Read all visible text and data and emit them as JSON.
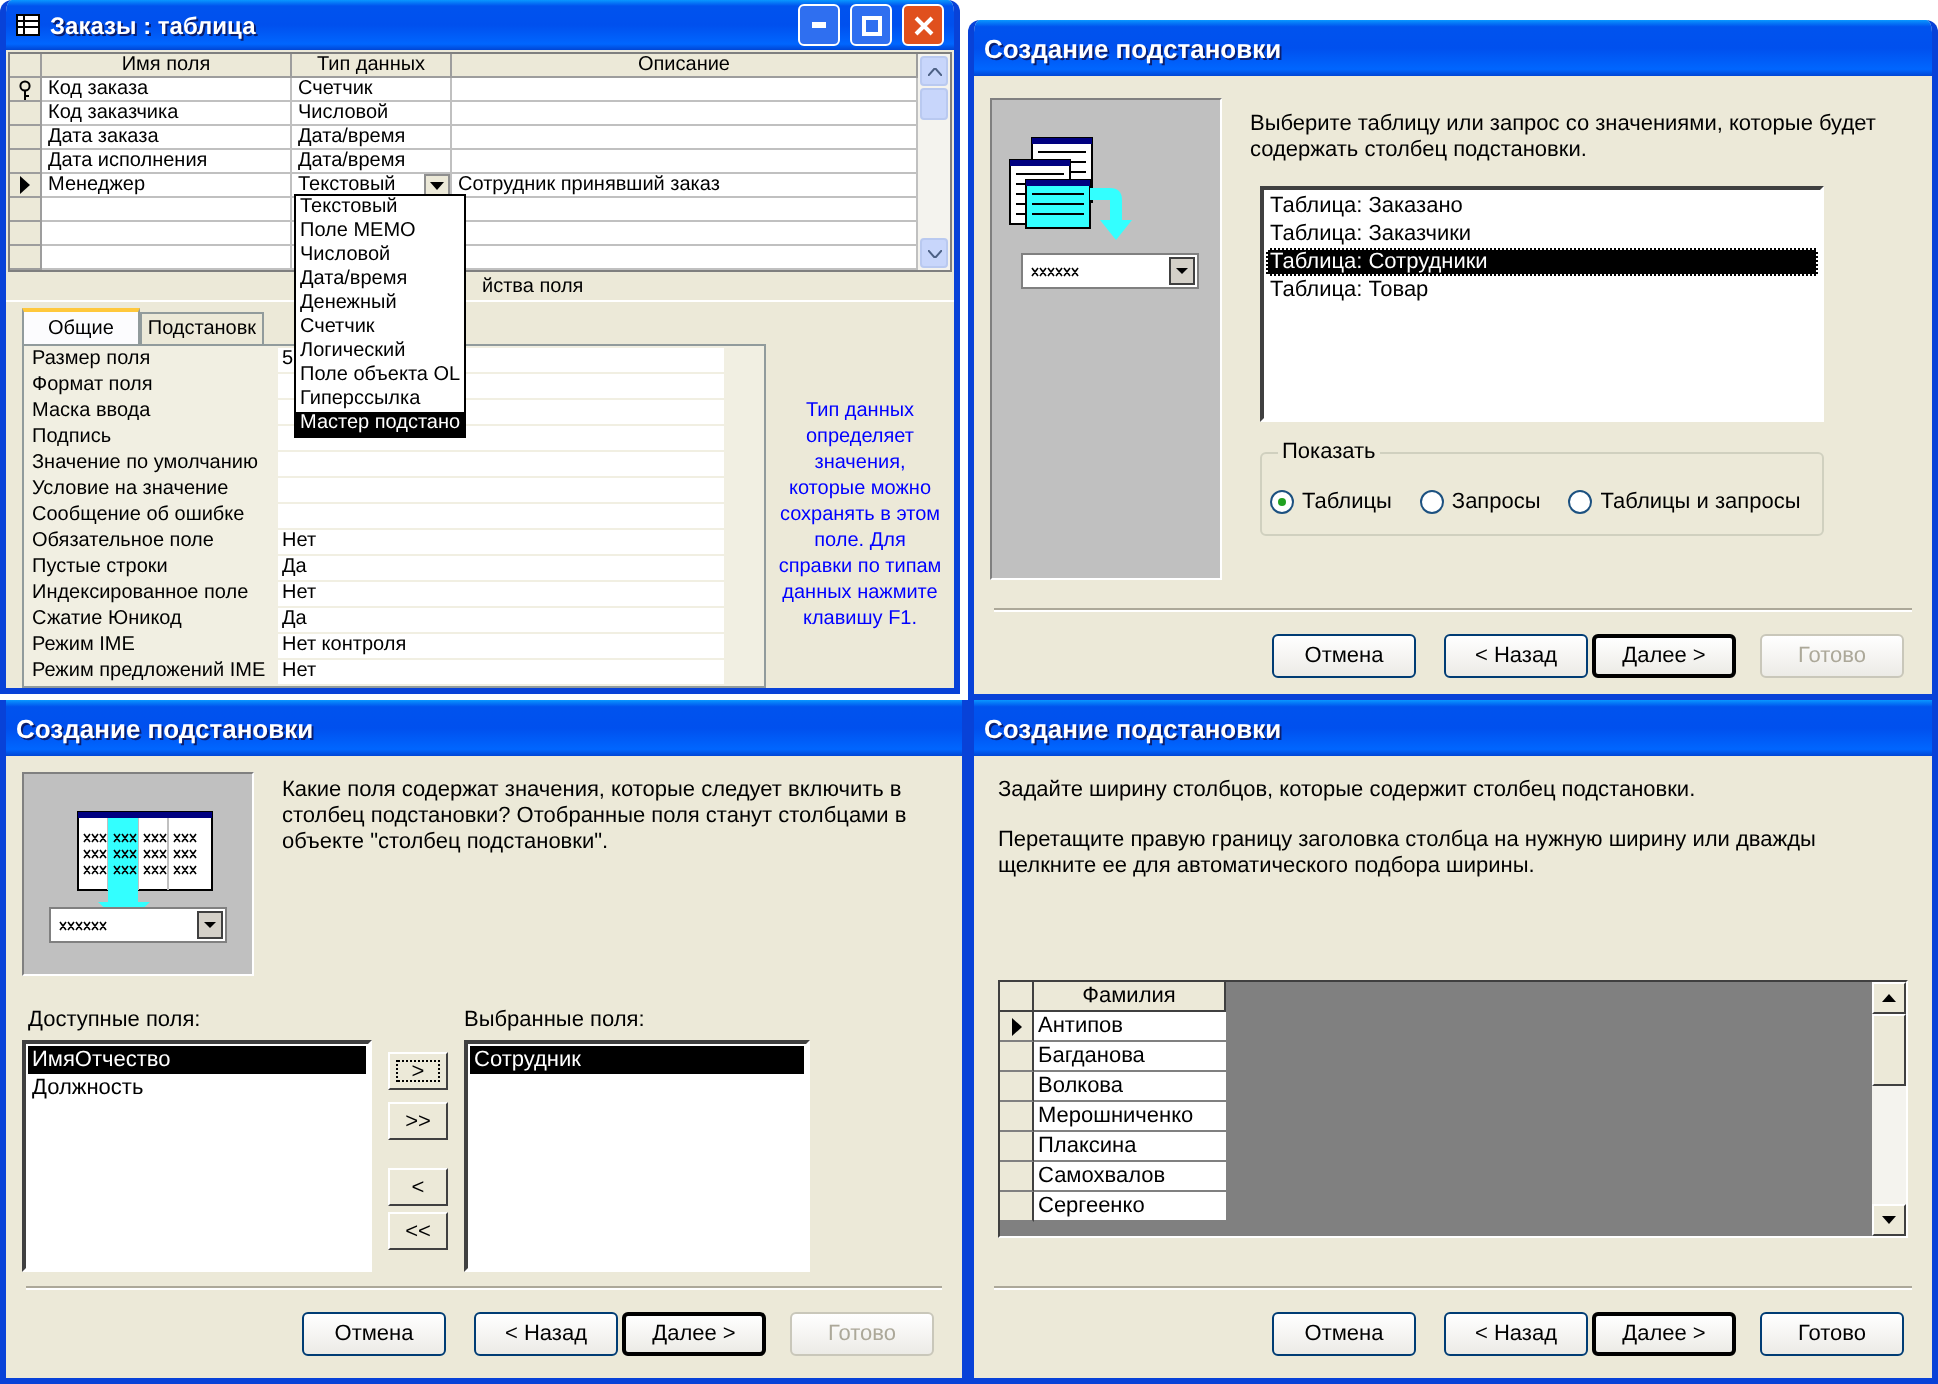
{
  "table_window": {
    "title": "Заказы : таблица",
    "columns": [
      "Имя поля",
      "Тип данных",
      "Описание"
    ],
    "rows": [
      {
        "name": "Код заказа",
        "type": "Счетчик",
        "key": true,
        "current": false
      },
      {
        "name": "Код заказчика",
        "type": "Числовой",
        "key": false,
        "current": false
      },
      {
        "name": "Дата заказа",
        "type": "Дата/время",
        "key": false,
        "current": false
      },
      {
        "name": "Дата исполнения",
        "type": "Дата/время",
        "key": false,
        "current": false
      },
      {
        "name": "Менеджер",
        "type": "Текстовый",
        "description": "Сотрудник принявший заказ",
        "key": false,
        "current": true
      }
    ],
    "type_dropdown": [
      {
        "label": "Текстовый",
        "selected": false
      },
      {
        "label": "Поле MEMO",
        "selected": false
      },
      {
        "label": "Числовой",
        "selected": false
      },
      {
        "label": "Дата/время",
        "selected": false
      },
      {
        "label": "Денежный",
        "selected": false
      },
      {
        "label": "Счетчик",
        "selected": false
      },
      {
        "label": "Логический",
        "selected": false
      },
      {
        "label": "Поле объекта OL",
        "selected": false
      },
      {
        "label": "Гиперссылка",
        "selected": false
      },
      {
        "label": "Мастер подстано",
        "selected": true
      }
    ],
    "properties_caption": "йства поля",
    "tabs": [
      {
        "label": "Общие",
        "selected": true
      },
      {
        "label": "Подстановк",
        "selected": false
      }
    ],
    "properties": [
      {
        "label": "Размер поля",
        "value": "5"
      },
      {
        "label": "Формат поля"
      },
      {
        "label": "Маска ввода"
      },
      {
        "label": "Подпись"
      },
      {
        "label": "Значение по умолчанию"
      },
      {
        "label": "Условие на значение"
      },
      {
        "label": "Сообщение об ошибке"
      },
      {
        "label": "Обязательное поле",
        "value": "Нет"
      },
      {
        "label": "Пустые строки",
        "value": "Да"
      },
      {
        "label": "Индексированное поле",
        "value": "Нет"
      },
      {
        "label": "Сжатие Юникод",
        "value": "Да"
      },
      {
        "label": "Режим IME",
        "value": "Нет контроля"
      },
      {
        "label": "Режим предложений IME",
        "value": "Нет"
      }
    ],
    "help": "Тип данных определяет значения, которые можно сохранять в этом поле. Для справки по типам данных нажмите клавишу F1."
  },
  "wizard_source": {
    "title": "Создание подстановки",
    "prompt": "Выберите таблицу или запрос со значениями, которые будет содержать столбец подстановки.",
    "items": [
      {
        "label": "Таблица: Заказано",
        "selected": false
      },
      {
        "label": "Таблица: Заказчики",
        "selected": false
      },
      {
        "label": "Таблица: Сотрудники",
        "selected": true
      },
      {
        "label": "Таблица: Товар",
        "selected": false
      }
    ],
    "show_label": "Показать",
    "show_options": [
      {
        "label": "Таблицы",
        "selected": true
      },
      {
        "label": "Запросы",
        "selected": false
      },
      {
        "label": "Таблицы и запросы",
        "selected": false
      }
    ],
    "buttons": [
      {
        "label": "Отмена",
        "disabled": false,
        "default": false
      },
      {
        "label": "< Назад",
        "disabled": false,
        "default": false
      },
      {
        "label": "Далее >",
        "disabled": false,
        "default": true
      },
      {
        "label": "Готово",
        "disabled": true,
        "default": false
      }
    ]
  },
  "wizard_fields": {
    "title": "Создание подстановки",
    "prompt": "Какие поля содержат значения, которые следует включить в столбец подстановки? Отобранные поля станут столбцами в объекте \"столбец подстановки\".",
    "available_label": "Доступные поля:",
    "available": [
      {
        "label": "ИмяОтчество",
        "selected": true
      },
      {
        "label": "Должность",
        "selected": false
      }
    ],
    "selected_label": "Выбранные поля:",
    "chosen": [
      {
        "label": "Сотрудник",
        "selected": true
      }
    ],
    "move_buttons": [
      {
        "label": ">",
        "focused": true
      },
      {
        "label": ">>",
        "focused": false
      },
      {
        "label": "<",
        "focused": false
      },
      {
        "label": "<<",
        "focused": false
      }
    ],
    "buttons": [
      {
        "label": "Отмена",
        "disabled": false,
        "default": false
      },
      {
        "label": "< Назад",
        "disabled": false,
        "default": false
      },
      {
        "label": "Далее >",
        "disabled": false,
        "default": true
      },
      {
        "label": "Готово",
        "disabled": true,
        "default": false
      }
    ]
  },
  "wizard_widths": {
    "title": "Создание подстановки",
    "instructions": [
      "Задайте ширину столбцов, которые содержит столбец подстановки.",
      "Перетащите правую границу заголовка столбца на нужную ширину или дважды щелкните ее для автоматического подбора ширины."
    ],
    "column": "Фамилия",
    "rows": [
      {
        "value": "Антипов",
        "current": true
      },
      {
        "value": "Багданова",
        "current": false
      },
      {
        "value": "Волкова",
        "current": false
      },
      {
        "value": "Мерошниченко",
        "current": false
      },
      {
        "value": "Плаксина",
        "current": false
      },
      {
        "value": "Самохвалов",
        "current": false
      },
      {
        "value": "Сергеенко",
        "current": false
      }
    ],
    "buttons": [
      {
        "label": "Отмена",
        "disabled": false,
        "default": false
      },
      {
        "label": "< Назад",
        "disabled": false,
        "default": false
      },
      {
        "label": "Далее >",
        "disabled": false,
        "default": true
      },
      {
        "label": "Готово",
        "disabled": false,
        "default": false
      }
    ]
  }
}
